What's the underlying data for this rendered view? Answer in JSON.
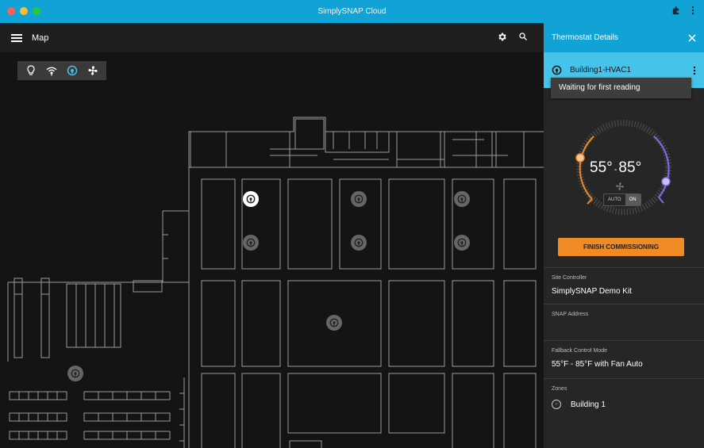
{
  "window": {
    "title": "SimplySNAP Cloud",
    "traffic_colors": [
      "#fe5f57",
      "#febc2e",
      "#28c840"
    ]
  },
  "appbar": {
    "title": "Map"
  },
  "map": {
    "toolbar": [
      "lightbulb-icon",
      "wireless-sensor-icon",
      "thermostat-icon",
      "fan-icon"
    ],
    "active_tool": "thermostat-icon"
  },
  "panel": {
    "title": "Thermostat Details",
    "device_name": "Building1-HVAC1",
    "status_message": "Waiting for first reading",
    "heat_setpoint": "55",
    "cool_setpoint": "85",
    "degree": "°",
    "separator": "-",
    "fan_modes": {
      "auto": "AUTO",
      "on": "ON"
    },
    "fan_mode_selected": "ON",
    "commission_button": "FINISH COMMISSIONING",
    "site_controller": {
      "label": "Site Controller",
      "value": "SimplySNAP Demo Kit"
    },
    "snap_address": {
      "label": "SNAP Address",
      "value": ""
    },
    "fallback": {
      "label": "Fallback Control Mode",
      "value": "55°F - 85°F with Fan Auto"
    },
    "zones": {
      "label": "Zones",
      "items": [
        "Building 1"
      ]
    }
  },
  "colors": {
    "titlebar": "#12a3d6",
    "device_row": "#46c3ea",
    "heat": "#f08a24",
    "cool": "#7b6ff0",
    "button": "#f08a24"
  }
}
